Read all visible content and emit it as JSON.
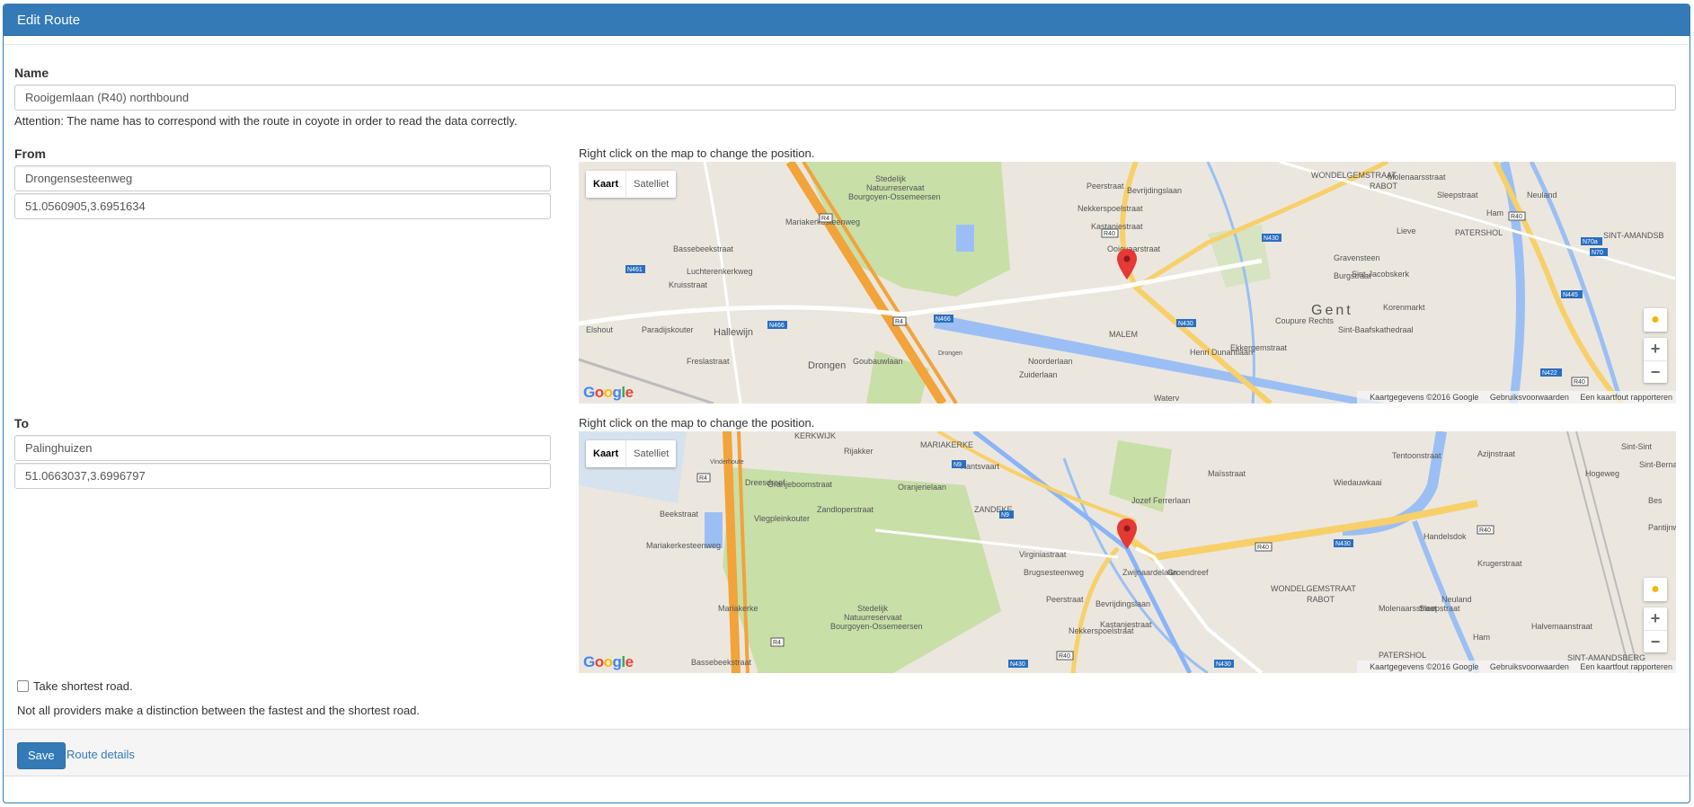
{
  "panel": {
    "title": "Edit Route"
  },
  "name": {
    "label": "Name",
    "value": "Rooigemlaan (R40) northbound",
    "help": "Attention: The name has to correspond with the route in coyote in order to read the data correctly."
  },
  "from": {
    "label": "From",
    "address": "Drongensesteenweg",
    "coords": "51.0560905,3.6951634",
    "map_hint": "Right click on the map to change the position."
  },
  "to": {
    "label": "To",
    "address": "Palinghuizen",
    "coords": "51.0663037,3.6996797",
    "map_hint": "Right click on the map to change the position."
  },
  "map": {
    "type_map": "Kaart",
    "type_satellite": "Satelliet",
    "zoom_in": "+",
    "zoom_out": "−",
    "logo": "Google",
    "attribution_data": "Kaartgegevens ©2016 Google",
    "attribution_terms": "Gebruiksvoorwaarden",
    "attribution_report": "Een kaartfout rapporteren",
    "pegman_icon": "pegman-icon",
    "marker_color": "#e53935",
    "labels_from": [
      "Stedelijk",
      "Natuurreservaat",
      "Bourgoyen-Ossemeersen",
      "WONDELGEMSTRAAT",
      "RABOT",
      "PATERSHOL",
      "SINT-AMANDSB",
      "Gravensteen",
      "Sint-Jacobskerk",
      "Burgstraat",
      "Gent",
      "Korenmarkt",
      "Sint-Baafskathedraal",
      "Hallewijn",
      "Drongen",
      "Drongen",
      "MALEM",
      "Noorderlaan",
      "Zuiderlaan",
      "Ooievaarstraat",
      "Kastanjestraat",
      "Luchterenkerkweg",
      "Bassebeekstraat",
      "Mariakerkesteenweg",
      "Freslastraat",
      "Elshout",
      "Paradijskouter",
      "Kruisstraat",
      "Peerstraat",
      "Nekkerspoelstraat",
      "Bevrijdingslaan",
      "Henri Dunantlaan",
      "Ekkergemstraat",
      "Coupure Rechts",
      "Lieve",
      "Neuland",
      "Ham",
      "Sleepstraat",
      "Molenaarsstraat",
      "Goubauwlaan",
      "Waterv"
    ],
    "labels_to": [
      "KERKWIJK",
      "MARIAKERKE",
      "Vinderhoute",
      "ZANDEKE",
      "Stedelijk",
      "Natuurreservaat",
      "Bourgoyen-Ossemeersen",
      "WONDELGEMSTRAAT",
      "RABOT",
      "PATERSHOL",
      "SINT-AMANDSBERG",
      "Rijakker",
      "Oranjeboomstraat",
      "Zandloperstraat",
      "Oranjerielaan",
      "Kantsvaart",
      "Vlegpleinkouter",
      "Beekstraat",
      "Mariakerkesteenweg",
      "Bassebeekstraat",
      "Brugsesteenweg",
      "Jozef Ferrerlaan",
      "Maïsstraat",
      "Bevrijdingslaan",
      "Kastanjestraat",
      "Peerstraat",
      "Nekkerspoelstraat",
      "Ham",
      "Sleepstraat",
      "Neuland",
      "Molenaarsstraat",
      "Tentoonstraat",
      "Azijnstraat",
      "Wiedauwkaai",
      "Handelsdok",
      "Krugerstraat",
      "Halvemaanstraat",
      "Dreesdreef",
      "Zwijnaardelaan",
      "Groendreef",
      "Virginiastraat",
      "Pantijnweg",
      "Hogeweg",
      "Sint-Bernard",
      "Sint-Sint",
      "Bes",
      "Mariakerke"
    ],
    "shields": [
      "R4",
      "N461",
      "N466",
      "N466",
      "R4",
      "R40",
      "N430",
      "N430",
      "R40",
      "N70a",
      "N70",
      "N445",
      "N422",
      "R40",
      "R4",
      "N9",
      "N9",
      "R40",
      "N430",
      "R40",
      "N430",
      "R40",
      "R4",
      "N430"
    ]
  },
  "options": {
    "shortest_label": "Take shortest road.",
    "shortest_checked": false,
    "note": "Not all providers make a distinction between the fastest and the shortest road."
  },
  "footer": {
    "save": "Save",
    "details": "Route details"
  }
}
